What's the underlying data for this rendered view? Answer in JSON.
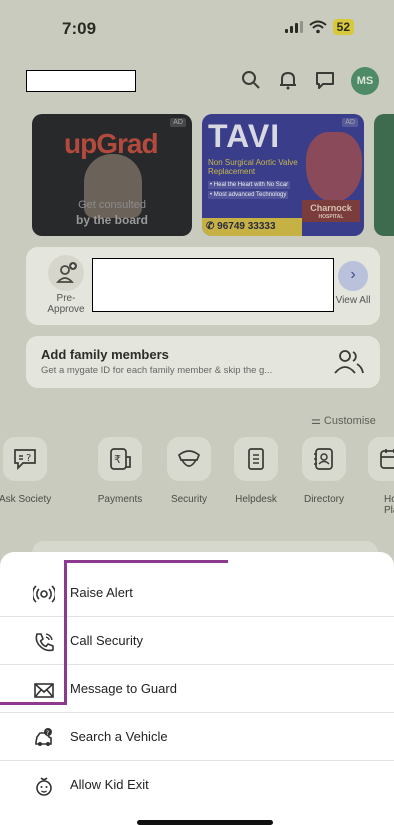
{
  "status_bar": {
    "time": "7:09",
    "battery": "52"
  },
  "header": {
    "avatar_initials": "MS"
  },
  "banners": {
    "upgrad": {
      "brand": "upGrad",
      "caption_line1": "Get consulted",
      "caption_line2": "by the board",
      "ad_tag": "AD"
    },
    "tavi": {
      "title": "TAVI",
      "subtitle": "Non Surgical Aortic Valve Replacement",
      "bullet1": "• Heal the Heart with No Scar",
      "bullet2": "• Most advanced Technology",
      "hospital": "Charnock",
      "hospital_sub": "HOSPITAL",
      "phone": "✆ 96749 33333",
      "ad_tag": "AD"
    }
  },
  "pre_approve": {
    "label": "Pre-Approve",
    "view_all": "View All"
  },
  "family": {
    "title": "Add family members",
    "subtitle": "Get a mygate ID for each family member & skip the g..."
  },
  "customise": "Customise",
  "tiles": [
    {
      "label": "Ask Society",
      "icon": "chat-question-icon"
    },
    {
      "label": "Payments",
      "icon": "rupee-card-icon"
    },
    {
      "label": "Security",
      "icon": "guard-cap-icon"
    },
    {
      "label": "Helpdesk",
      "icon": "ticket-icon"
    },
    {
      "label": "Directory",
      "icon": "contact-book-icon"
    },
    {
      "label": "Hom Plan",
      "icon": "calendar-icon"
    }
  ],
  "sheet": {
    "items": [
      {
        "label": "Raise Alert",
        "icon": "alert-signal-icon"
      },
      {
        "label": "Call Security",
        "icon": "phone-icon"
      },
      {
        "label": "Message to Guard",
        "icon": "envelope-icon"
      },
      {
        "label": "Search a Vehicle",
        "icon": "car-search-icon"
      },
      {
        "label": "Allow Kid Exit",
        "icon": "kid-icon"
      }
    ]
  },
  "colors": {
    "highlight": "#8b3a8f",
    "avatar": "#4f8a66",
    "backdrop": "#c9cbbf"
  }
}
